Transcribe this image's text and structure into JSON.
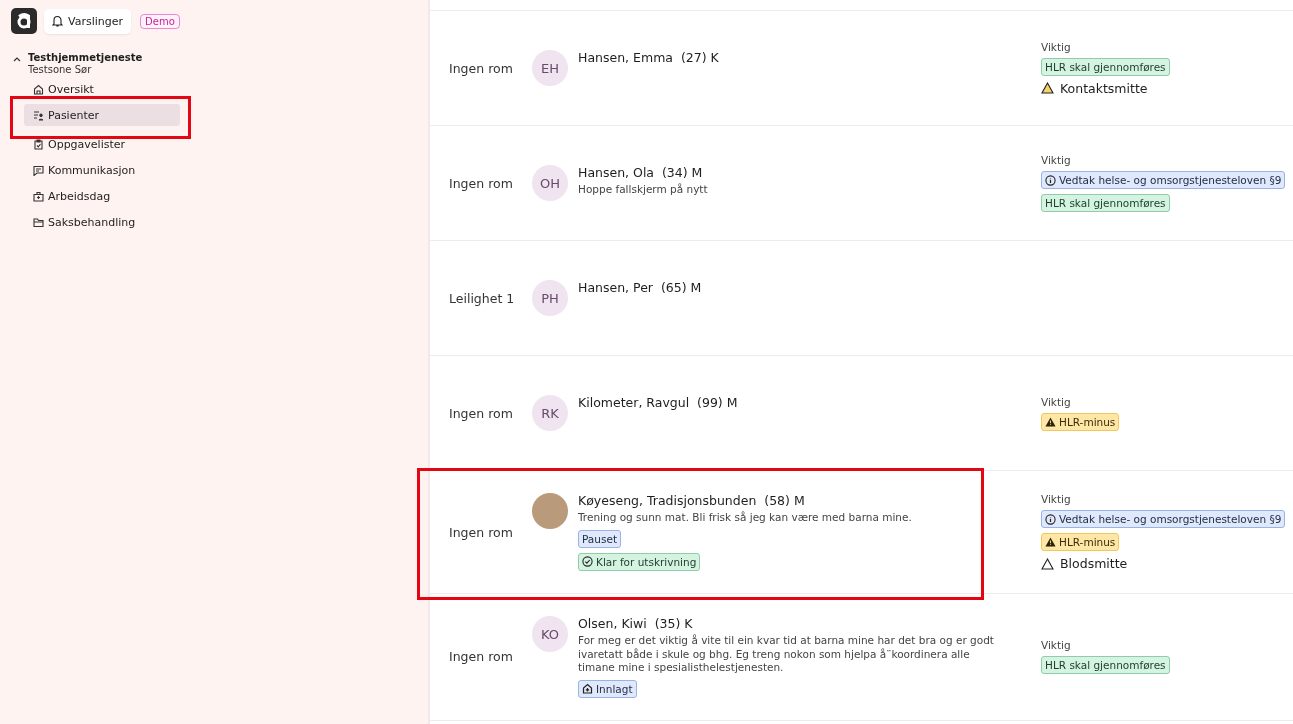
{
  "header": {
    "notifications": "Varslinger",
    "badge": "Demo"
  },
  "sidebar": {
    "group": {
      "title": "Testhjemmetjeneste",
      "subtitle": "Testsone Sør",
      "expanded": true
    },
    "items": [
      {
        "label": "Oversikt",
        "selected": false
      },
      {
        "label": "Pasienter",
        "selected": true
      },
      {
        "label": "Oppgavelister",
        "selected": false
      },
      {
        "label": "Kommunikasjon",
        "selected": false
      },
      {
        "label": "Arbeidsdag",
        "selected": false
      },
      {
        "label": "Saksbehandling",
        "selected": false
      }
    ]
  },
  "patients": [
    {
      "room": "Ingen rom",
      "avatar": {
        "kind": "initials",
        "initials": "EH"
      },
      "name": "Hansen, Emma",
      "age": "(27)",
      "sex": "K",
      "important_label": "Viktig",
      "flags": [
        {
          "kind": "success",
          "label": "HLR skal gjennomføres"
        },
        {
          "kind": "risk-warning",
          "label": "Kontaktsmitte"
        }
      ]
    },
    {
      "room": "Ingen rom",
      "avatar": {
        "kind": "initials",
        "initials": "OH"
      },
      "name": "Hansen, Ola",
      "age": "(34)",
      "sex": "M",
      "goal": "Hoppe fallskjerm på nytt",
      "important_label": "Viktig",
      "flags": [
        {
          "kind": "info",
          "label": "Vedtak helse- og omsorgstjenesteloven §9"
        },
        {
          "kind": "success",
          "label": "HLR skal gjennomføres"
        }
      ]
    },
    {
      "room": "Leilighet 1",
      "avatar": {
        "kind": "initials",
        "initials": "PH"
      },
      "name": "Hansen, Per",
      "age": "(65)",
      "sex": "M"
    },
    {
      "room": "Ingen rom",
      "avatar": {
        "kind": "initials",
        "initials": "RK"
      },
      "name": "Kilometer, Ravgul",
      "age": "(99)",
      "sex": "M",
      "important_label": "Viktig",
      "flags": [
        {
          "kind": "warning",
          "label": "HLR-minus"
        }
      ]
    },
    {
      "room": "Ingen rom",
      "avatar": {
        "kind": "photo"
      },
      "name": "Køyeseng, Tradisjonsbunden",
      "age": "(58)",
      "sex": "M",
      "goal": "Trening og sunn mat. Bli frisk så jeg kan være med barna mine.",
      "status_tags": [
        {
          "kind": "paused",
          "label": "Pauset"
        },
        {
          "kind": "discharge",
          "label": "Klar for utskrivning"
        }
      ],
      "important_label": "Viktig",
      "flags": [
        {
          "kind": "info",
          "label": "Vedtak helse- og omsorgstjenesteloven §9"
        },
        {
          "kind": "warning",
          "label": "HLR-minus"
        },
        {
          "kind": "risk-plain",
          "label": "Blodsmitte"
        }
      ]
    },
    {
      "room": "Ingen rom",
      "avatar": {
        "kind": "initials",
        "initials": "KO"
      },
      "name": "Olsen, Kiwi",
      "age": "(35)",
      "sex": "K",
      "goal": "For meg er det viktig å vite til ein kvar tid at barna mine har det bra og er godt ivaretatt både i skule og bhg. Eg treng nokon som hjelpa å¨koordinera alle timane mine i spesialisthelestjenesten.",
      "status_tags": [
        {
          "kind": "admitted",
          "label": "Innlagt"
        }
      ],
      "important_label": "Viktig",
      "flags": [
        {
          "kind": "success",
          "label": "HLR skal gjennomføres"
        }
      ]
    }
  ]
}
